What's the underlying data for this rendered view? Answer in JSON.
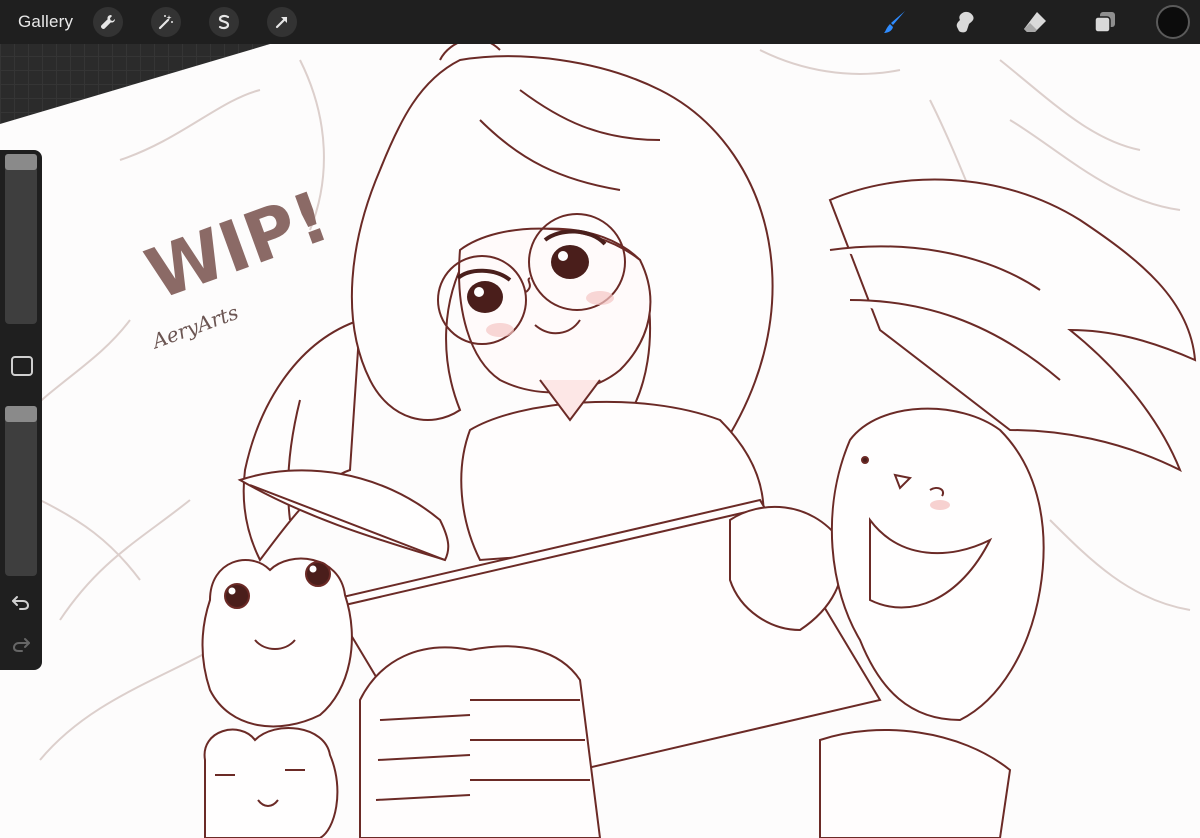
{
  "app": {
    "gallery_label": "Gallery"
  },
  "toolbar": {
    "left_tools": [
      "wrench-icon",
      "magic-wand-icon",
      "selection-icon",
      "transform-arrow-icon"
    ],
    "right_tools": [
      "brush-icon",
      "smudge-icon",
      "eraser-icon",
      "layers-icon"
    ],
    "active_tool": "brush",
    "active_tool_color": "#2f8cff",
    "current_color": "#0c0c0c"
  },
  "sidebar": {
    "brush_size_level": 0.0,
    "opacity_level": 0.0,
    "controls": [
      "brush-size-slider",
      "modify-button",
      "opacity-slider",
      "undo-icon",
      "redo-icon"
    ]
  },
  "artwork": {
    "wip_text": "WIP!",
    "signature": "AeryArts",
    "line_color": "#6b2a26",
    "sketch_color": "#d6c6c3"
  }
}
